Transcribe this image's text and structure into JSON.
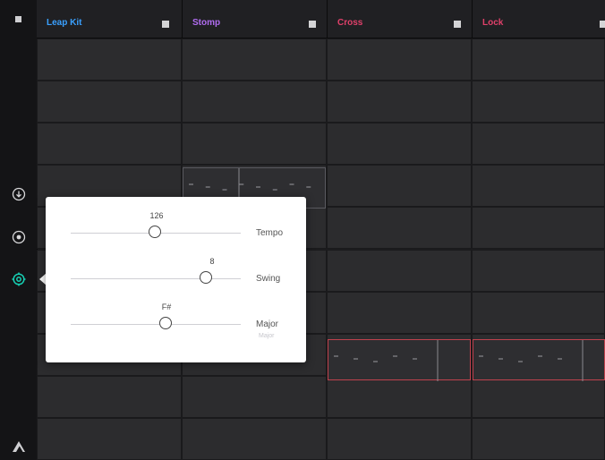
{
  "colors": {
    "track_leap_kit": "#3aa0ff",
    "track_stomp": "#b06cf0",
    "track_cross": "#e0406a",
    "track_lock": "#e0406a",
    "active_icon": "#16d1b4",
    "clip_outline_red": "#c0424e"
  },
  "sidebar": {
    "stop_icon": "stop-square-icon",
    "buttons": [
      {
        "name": "download-icon",
        "active": false
      },
      {
        "name": "record-icon",
        "active": false
      },
      {
        "name": "settings-icon",
        "active": true
      }
    ],
    "logo_icon": "app-logo-icon"
  },
  "tracks": [
    {
      "name": "Leap Kit",
      "stop_icon": "stop-square-icon"
    },
    {
      "name": "Stomp",
      "stop_icon": "stop-square-icon"
    },
    {
      "name": "Cross",
      "stop_icon": "stop-square-icon"
    },
    {
      "name": "Lock",
      "stop_icon": "stop-square-icon"
    }
  ],
  "settings_popover": {
    "sliders": [
      {
        "label": "Tempo",
        "value_text": "126",
        "level": 0.5
      },
      {
        "label": "Swing",
        "value_text": "8",
        "level": 0.8
      },
      {
        "label": "Major",
        "value_text": "F#",
        "level": 0.56,
        "sublabel": "Major"
      }
    ]
  }
}
